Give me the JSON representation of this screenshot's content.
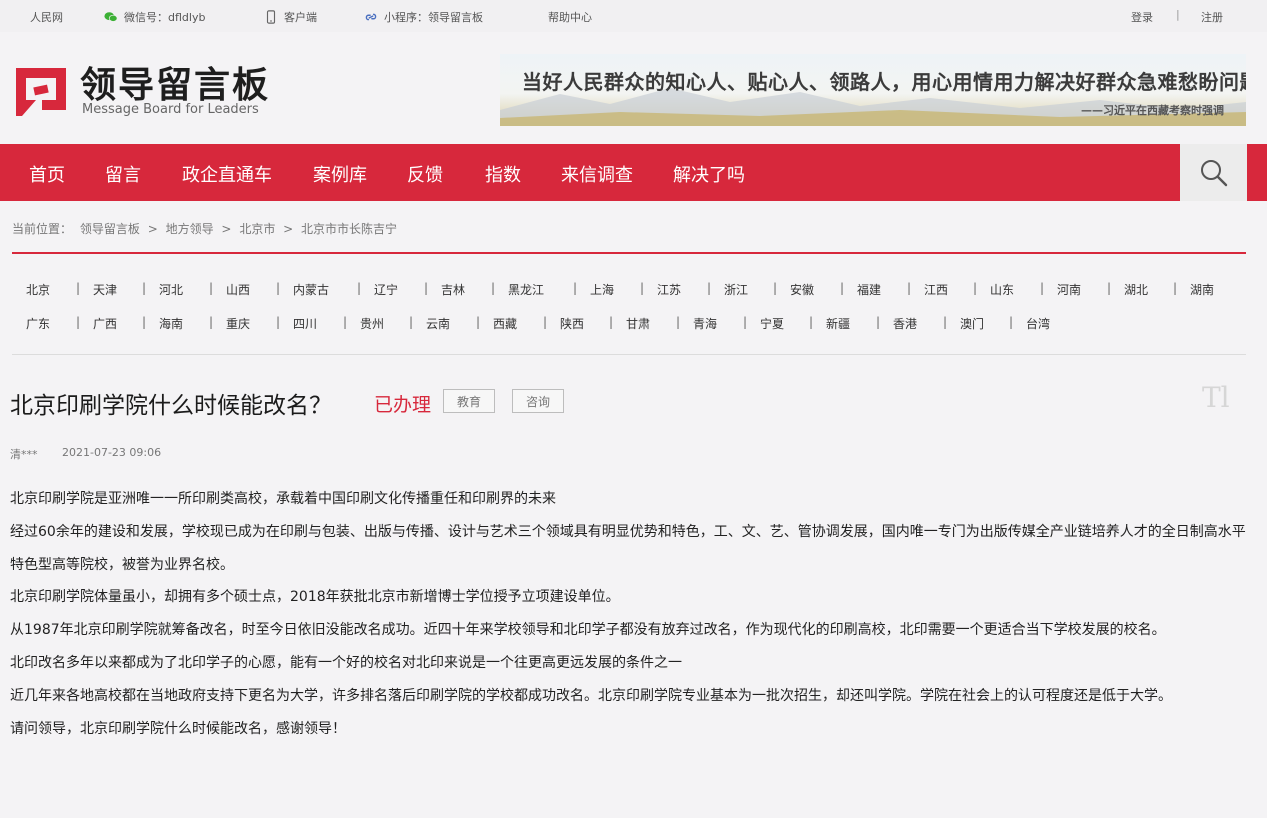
{
  "topbar": {
    "people": "人民网",
    "wechat": "微信号：dfldlyb",
    "client": "客户端",
    "mini": "小程序：领导留言板",
    "help": "帮助中心",
    "login": "登录",
    "divider": "|",
    "register": "注册"
  },
  "header": {
    "logo_cn": "领导留言板",
    "logo_en": "Message Board for Leaders",
    "banner_main": "当好人民群众的知心人、贴心人、领路人，用心用情用力解决好群众急难愁盼问题。",
    "banner_sub": "——习近平在西藏考察时强调"
  },
  "nav": {
    "items": [
      "首页",
      "留言",
      "政企直通车",
      "案例库",
      "反馈",
      "指数",
      "来信调查",
      "解决了吗"
    ]
  },
  "breadcrumb": {
    "items": [
      "当前位置：",
      "领导留言板",
      ">",
      "地方领导",
      ">",
      "北京市",
      ">",
      "北京市市长陈吉宁"
    ]
  },
  "provinces": {
    "row1": [
      "北京",
      "天津",
      "河北",
      "山西",
      "内蒙古",
      "辽宁",
      "吉林",
      "黑龙江",
      "上海",
      "江苏",
      "浙江",
      "安徽",
      "福建",
      "江西",
      "山东",
      "河南",
      "湖北",
      "湖南"
    ],
    "row2": [
      "广东",
      "广西",
      "海南",
      "重庆",
      "四川",
      "贵州",
      "云南",
      "西藏",
      "陕西",
      "甘肃",
      "青海",
      "宁夏",
      "新疆",
      "香港",
      "澳门",
      "台湾"
    ],
    "pipe": "|"
  },
  "article": {
    "title": "北京印刷学院什么时候能改名？",
    "status": "已办理",
    "tags": [
      "教育",
      "咨询"
    ],
    "font_toggle": "Tl",
    "author": "清***",
    "date": "2021-07-23 09:06",
    "paragraphs": [
      "北京印刷学院是亚洲唯一一所印刷类高校，承载着中国印刷文化传播重任和印刷界的未来",
      "经过60余年的建设和发展，学校现已成为在印刷与包装、出版与传播、设计与艺术三个领域具有明显优势和特色，工、文、艺、管协调发展，国内唯一专门为出版传媒全产业链培养人才的全日制高水平特色型高等院校，被誉为业界名校。",
      "北京印刷学院体量虽小，却拥有多个硕士点，2018年获批北京市新增博士学位授予立项建设单位。",
      "从1987年北京印刷学院就筹备改名，时至今日依旧没能改名成功。近四十年来学校领导和北印学子都没有放弃过改名，作为现代化的印刷高校，北印需要一个更适合当下学校发展的校名。",
      "北印改名多年以来都成为了北印学子的心愿，能有一个好的校名对北印来说是一个往更高更远发展的条件之一",
      "近几年来各地高校都在当地政府支持下更名为大学，许多排名落后印刷学院的学校都成功改名。北京印刷学院专业基本为一批次招生，却还叫学院。学院在社会上的认可程度还是低于大学。",
      "请问领导，北京印刷学院什么时候能改名，感谢领导！"
    ]
  },
  "colors": {
    "brand_red": "#d7283c",
    "background": "#f4f3f5"
  },
  "icons": [
    "wechat-icon",
    "phone-icon",
    "link-icon",
    "search-icon",
    "logo-icon"
  ]
}
